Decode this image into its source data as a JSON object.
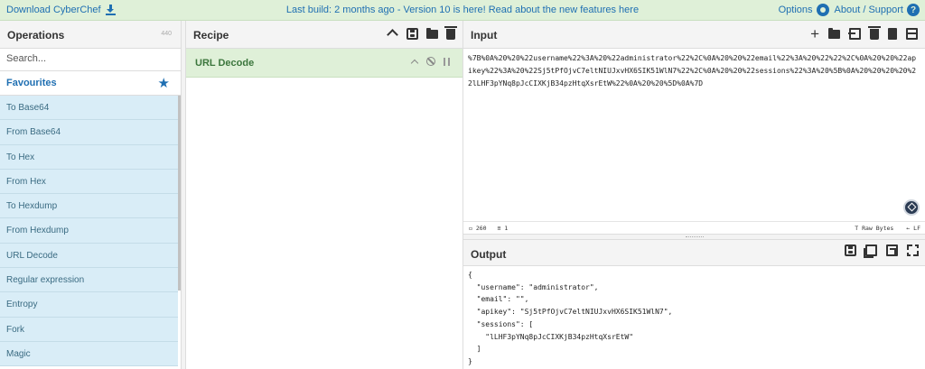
{
  "banner": {
    "download_label": "Download CyberChef",
    "message": "Last build: 2 months ago - Version 10 is here! Read about the new features here",
    "options_label": "Options",
    "about_label": "About / Support"
  },
  "operations": {
    "title": "Operations",
    "count": "440",
    "search_placeholder": "Search...",
    "favourites_label": "Favourites",
    "items": [
      "To Base64",
      "From Base64",
      "To Hex",
      "From Hex",
      "To Hexdump",
      "From Hexdump",
      "URL Decode",
      "Regular expression",
      "Entropy",
      "Fork",
      "Magic"
    ]
  },
  "recipe": {
    "title": "Recipe",
    "operation": "URL Decode"
  },
  "input": {
    "title": "Input",
    "text": "%7B%0A%20%20%22username%22%3A%20%22administrator%22%2C%0A%20%20%22email%22%3A%20%22%22%2C%0A%20%20%22apikey%22%3A%20%22Sj5tPfOjvC7eltNIUJxvHX6SIK51WlN7%22%2C%0A%20%20%22sessions%22%3A%20%5B%0A%20%20%20%20%22lLHF3pYNq8pJcCIXKjB34pzHtqXsrEtW%22%0A%20%20%5D%0A%7D",
    "length": "260",
    "lines": "1",
    "encoding": "Raw Bytes",
    "eol": "LF"
  },
  "output": {
    "title": "Output",
    "text": "{\n  \"username\": \"administrator\",\n  \"email\": \"\",\n  \"apikey\": \"Sj5tPfOjvC7eltNIUJxvHX6SIK51WlN7\",\n  \"sessions\": [\n    \"lLHF3pYNq8pJcCIXKjB34pzHtqXsrEtW\"\n  ]\n}"
  },
  "colors": {
    "accent": "#1f6fb2",
    "favourite_bg": "#d9edf7",
    "recipe_op_bg": "#dff0d8",
    "recipe_op_text": "#3c763d"
  }
}
